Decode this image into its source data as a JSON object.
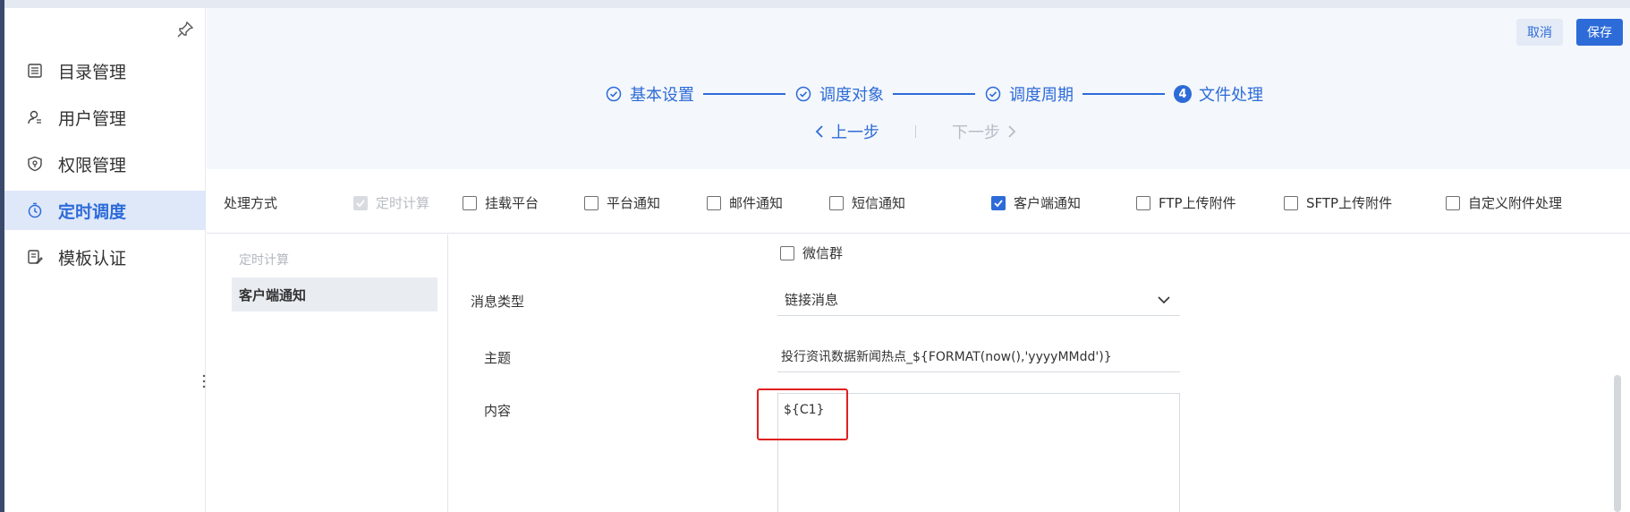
{
  "sidebar": {
    "items": [
      {
        "label": "目录管理",
        "icon": "list-icon",
        "active": false
      },
      {
        "label": "用户管理",
        "icon": "user-icon",
        "active": false
      },
      {
        "label": "权限管理",
        "icon": "shield-icon",
        "active": false
      },
      {
        "label": "定时调度",
        "icon": "clock-icon",
        "active": true
      },
      {
        "label": "模板认证",
        "icon": "template-icon",
        "active": false
      }
    ]
  },
  "header": {
    "cancel_label": "取消",
    "save_label": "保存"
  },
  "steps": [
    {
      "label": "基本设置",
      "state": "done"
    },
    {
      "label": "调度对象",
      "state": "done"
    },
    {
      "label": "调度周期",
      "state": "done"
    },
    {
      "label": "文件处理",
      "state": "current",
      "number": "4"
    }
  ],
  "stepnav": {
    "prev_label": "上一步",
    "next_label": "下一步"
  },
  "processing": {
    "label": "处理方式",
    "options": [
      {
        "label": "定时计算",
        "checked": true,
        "disabled": true
      },
      {
        "label": "挂载平台",
        "checked": false,
        "disabled": false
      },
      {
        "label": "平台通知",
        "checked": false,
        "disabled": false
      },
      {
        "label": "邮件通知",
        "checked": false,
        "disabled": false
      },
      {
        "label": "短信通知",
        "checked": false,
        "disabled": false
      },
      {
        "label": "客户端通知",
        "checked": true,
        "disabled": false
      },
      {
        "label": "FTP上传附件",
        "checked": false,
        "disabled": false
      },
      {
        "label": "SFTP上传附件",
        "checked": false,
        "disabled": false
      },
      {
        "label": "自定义附件处理",
        "checked": false,
        "disabled": false
      }
    ]
  },
  "leftlist": {
    "head": "定时计算",
    "selected": "客户端通知"
  },
  "form": {
    "wechat_label": "微信群",
    "msg_type_label": "消息类型",
    "msg_type_value": "链接消息",
    "subject_label": "主题",
    "subject_value": "投行资讯数据新闻热点_${FORMAT(now(),'yyyyMMdd')}",
    "content_label": "内容",
    "content_value": "${C1}"
  },
  "colors": {
    "accent": "#2d6bd8",
    "highlight": "#e02020"
  }
}
